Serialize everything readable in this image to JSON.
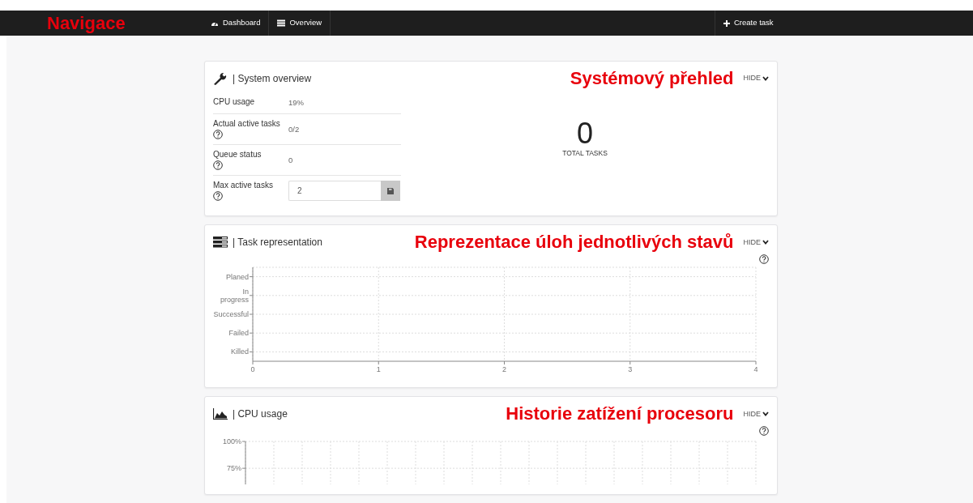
{
  "navbar": {
    "annotation": "Navigace",
    "items": [
      {
        "label": "Dashboard"
      },
      {
        "label": "Overview"
      }
    ],
    "action": {
      "label": "Create task"
    }
  },
  "panels": [
    {
      "kind": "overview",
      "title": "| System overview",
      "annotation": "Systémový přehled",
      "toggle": "HIDE",
      "stats": [
        {
          "kind": "text",
          "label": "CPU usage",
          "value": "19%",
          "help": false
        },
        {
          "kind": "text",
          "label": "Actual active tasks",
          "value": "0/2",
          "help": true
        },
        {
          "kind": "text",
          "label": "Queue status",
          "value": "0",
          "help": true
        },
        {
          "kind": "input",
          "label": "Max active tasks",
          "value": "2",
          "help": true
        }
      ],
      "total": {
        "value": "0",
        "label": "TOTAL TASKS"
      }
    },
    {
      "kind": "bars",
      "title": "| Task representation",
      "annotation": "Reprezentace úloh jednotlivých stavů",
      "toggle": "HIDE",
      "help": true,
      "chart_data": {
        "type": "bar",
        "orientation": "horizontal",
        "categories": [
          "Planed",
          "In progress",
          "Successful",
          "Failed",
          "Killed"
        ],
        "values": [
          0,
          0,
          0,
          0,
          0
        ],
        "xlim": [
          0,
          4
        ],
        "xticks": [
          0,
          1,
          2,
          3,
          4
        ],
        "grid": true
      }
    },
    {
      "kind": "line",
      "title": "| CPU usage",
      "annotation": "Historie zatížení procesoru",
      "toggle": "HIDE",
      "help": true,
      "chart_data": {
        "type": "line",
        "categories": [
          null,
          null,
          null,
          null,
          null,
          null,
          null,
          null,
          null,
          null,
          null,
          null,
          null,
          null,
          null,
          null,
          null,
          null,
          null
        ],
        "grid": true,
        "ylim": [
          60,
          100
        ],
        "yticks": [
          {
            "value": 100,
            "label": "100%"
          },
          {
            "value": 75,
            "label": "75%"
          }
        ]
      }
    }
  ]
}
